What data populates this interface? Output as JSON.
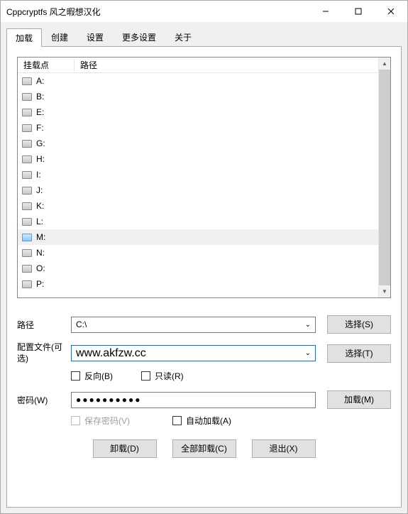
{
  "title": "Cppcryptfs 风之暇想汉化",
  "tabs": [
    "加载",
    "创建",
    "设置",
    "更多设置",
    "关于"
  ],
  "active_tab": 0,
  "list": {
    "headers": {
      "mount": "挂载点",
      "path": "路径"
    },
    "drives": [
      "A:",
      "B:",
      "E:",
      "F:",
      "G:",
      "H:",
      "I:",
      "J:",
      "K:",
      "L:",
      "M:",
      "N:",
      "O:",
      "P:"
    ],
    "selected": "M:"
  },
  "form": {
    "path_label": "路径",
    "path_value": "C:\\",
    "select_s": "选择(S)",
    "config_label": "配置文件(可选)",
    "config_value": "www.akfzw.cc",
    "select_t": "选择(T)",
    "reverse": "反向(B)",
    "readonly": "只读(R)",
    "password_label": "密码(W)",
    "password_value": "●●●●●●●●●●",
    "mount_btn": "加载(M)",
    "save_pwd": "保存密码(V)",
    "auto_mount": "自动加载(A)",
    "dismount": "卸载(D)",
    "dismount_all": "全部卸载(C)",
    "exit": "退出(X)"
  }
}
